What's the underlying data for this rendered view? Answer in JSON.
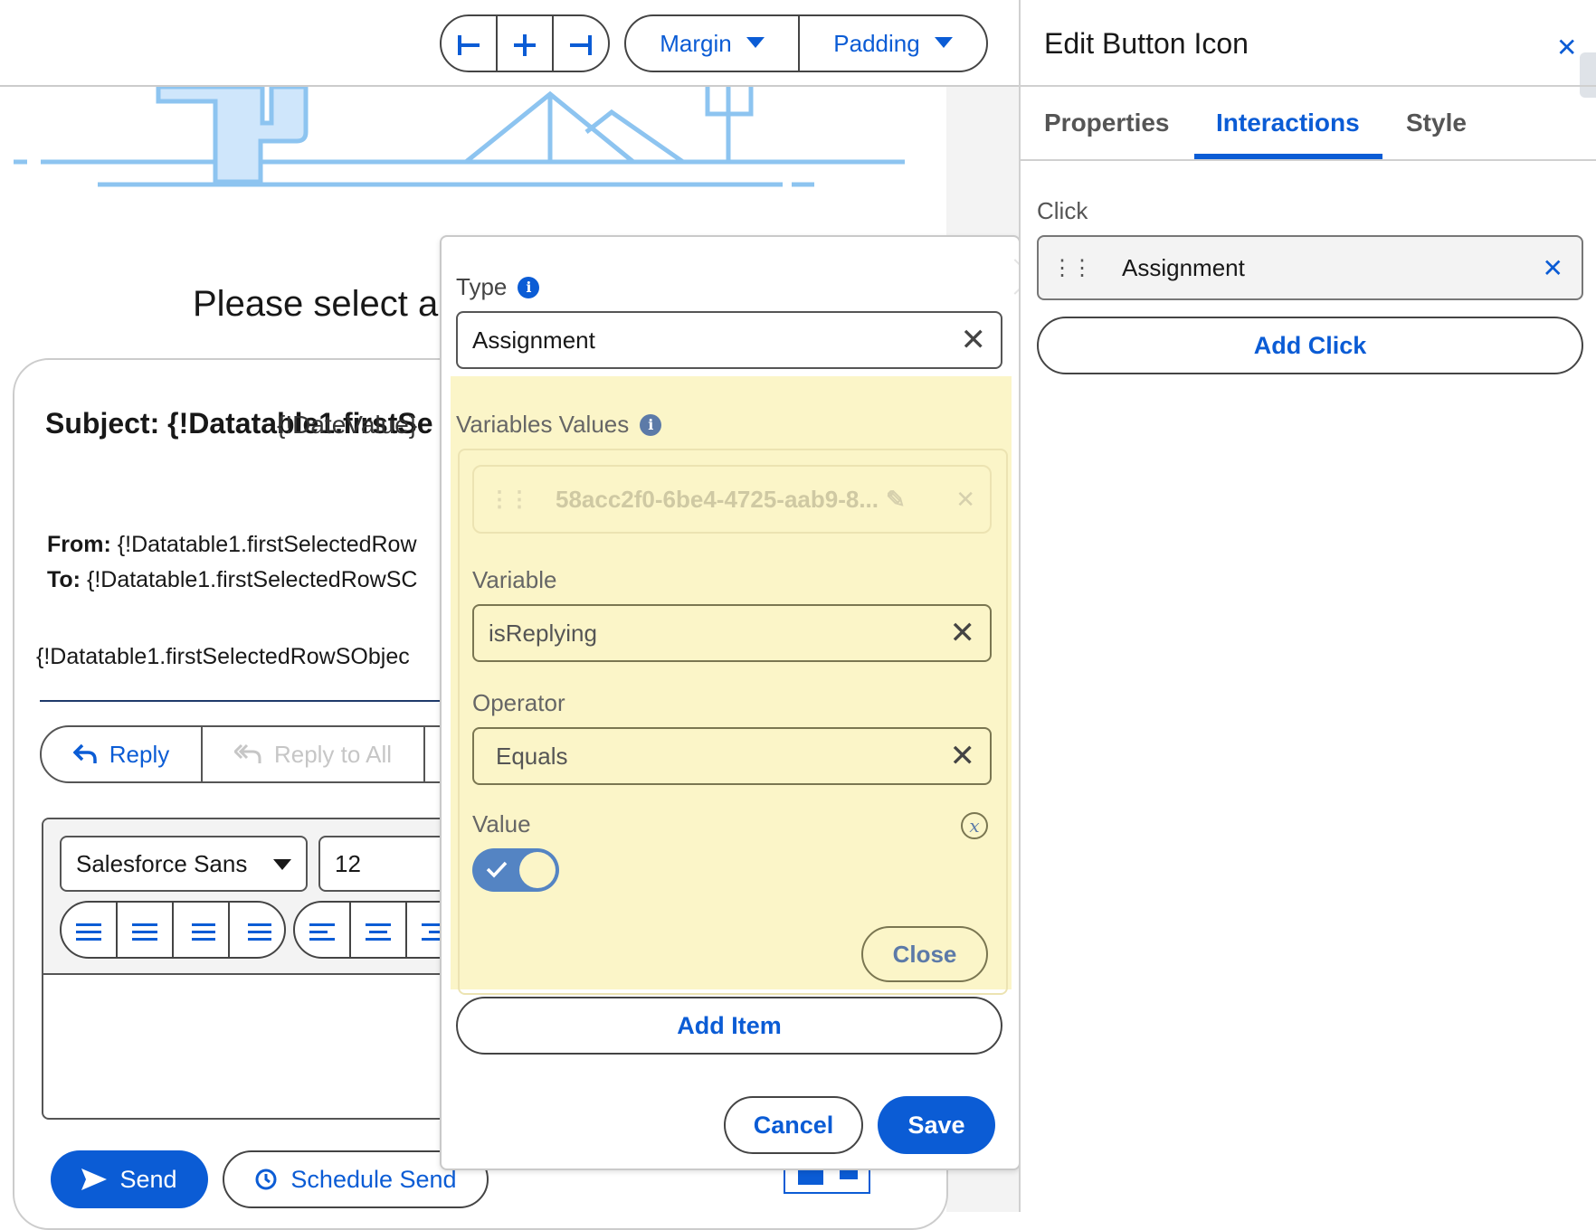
{
  "toolbar": {
    "align_left_icon": "align-left-icon",
    "add_icon": "plus-icon",
    "align_right_icon": "align-right-icon",
    "margin_label": "Margin",
    "padding_label": "Padding"
  },
  "canvas": {
    "heading": "Please select ar",
    "subject_label": "Subject:",
    "subject_value": "{!Datatab",
    "subject_overlap": "{!DateValue}",
    "subject_tail": "le1.firstSe",
    "from_label": "From:",
    "from_value": "{!Datatable1.firstSelectedRow",
    "to_label": "To:",
    "to_value": "{!Datatable1.firstSelectedRowSC",
    "body_value": "{!Datatable1.firstSelectedRowSObjec",
    "reply_label": "Reply",
    "reply_all_label": "Reply to All",
    "font_select": "Salesforce Sans",
    "font_size": "12",
    "send_label": "Send",
    "schedule_label": "Schedule Send"
  },
  "popover": {
    "type_label": "Type",
    "type_value": "Assignment",
    "variables_values_label": "Variables Values",
    "item_id": "58acc2f0-6be4-4725-aab9-8...",
    "variable_label": "Variable",
    "variable_value": "isReplying",
    "operator_label": "Operator",
    "operator_value": "Equals",
    "value_label": "Value",
    "value_toggle": true,
    "close_label": "Close",
    "add_item_label": "Add Item",
    "cancel_label": "Cancel",
    "save_label": "Save"
  },
  "panel": {
    "title": "Edit Button Icon",
    "tabs": [
      "Properties",
      "Interactions",
      "Style"
    ],
    "active_tab": "Interactions",
    "click_label": "Click",
    "click_item": "Assignment",
    "add_click_label": "Add Click"
  },
  "colors": {
    "accent": "#0b5cd5",
    "highlight": "#fbf5c8",
    "illustration": "#8dc4f0"
  }
}
